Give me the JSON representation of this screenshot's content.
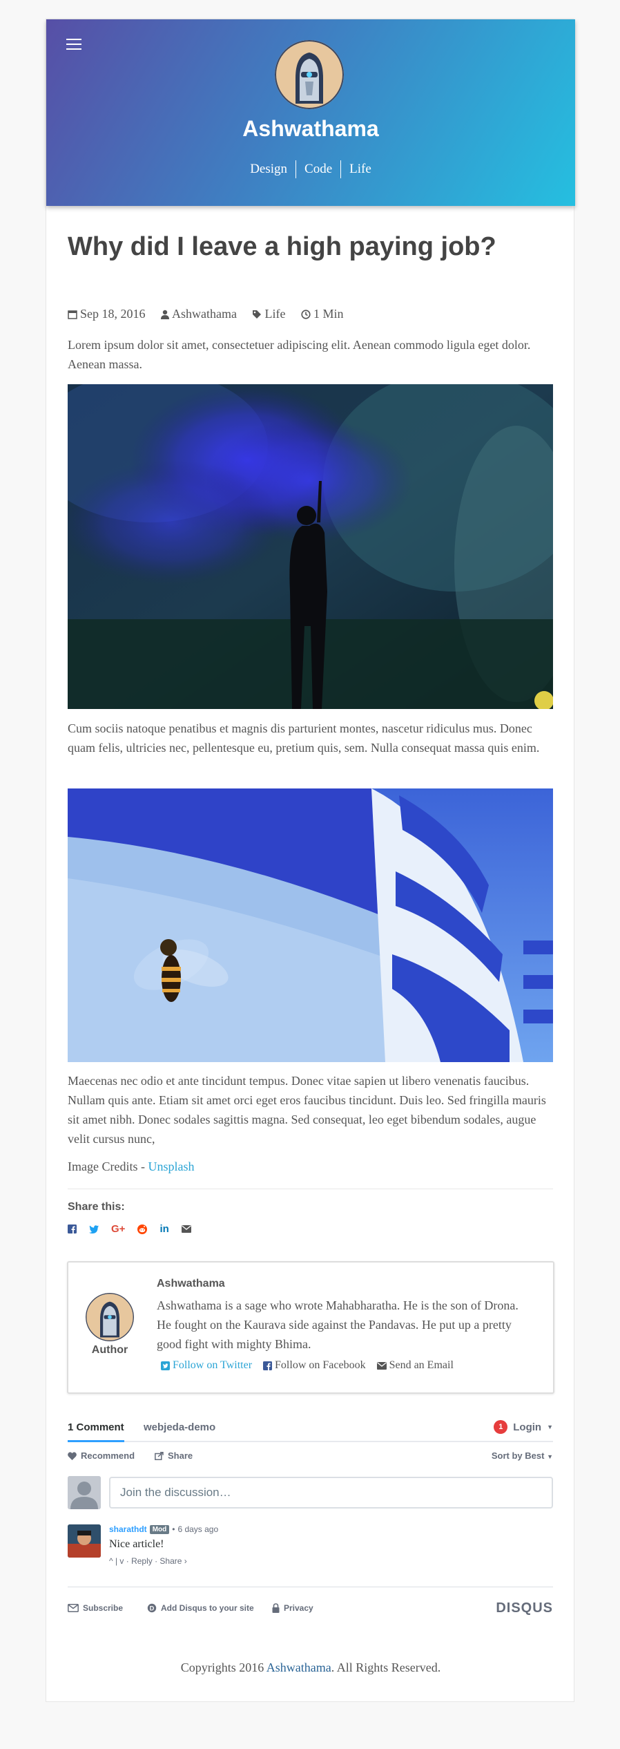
{
  "site": {
    "title": "Ashwathama",
    "nav": [
      "Design",
      "Code",
      "Life"
    ]
  },
  "post": {
    "title": "Why did I leave a high paying job?",
    "meta": {
      "date": "Sep 18, 2016",
      "author": "Ashwathama",
      "category": "Life",
      "read_time": "1 Min"
    },
    "paragraph1": "Lorem ipsum dolor sit amet, consectetuer adipiscing elit. Aenean commodo ligula eget dolor. Aenean massa.",
    "paragraph2": "Cum sociis natoque penatibus et magnis dis parturient montes, nascetur ridiculus mus. Donec quam felis, ultricies nec, pellentesque eu, pretium quis, sem. Nulla consequat massa quis enim.",
    "paragraph3": "Maecenas nec odio et ante tincidunt tempus. Donec vitae sapien ut libero venenatis faucibus. Nullam quis ante. Etiam sit amet orci eget eros faucibus tincidunt. Duis leo. Sed fringilla mauris sit amet nibh. Donec sodales sagittis magna. Sed consequat, leo eget bibendum sodales, augue velit cursus nunc,",
    "credits_prefix": "Image Credits - ",
    "credits_link": "Unsplash"
  },
  "share": {
    "title": "Share this:",
    "icons": [
      "facebook-icon",
      "twitter-icon",
      "google-plus-icon",
      "reddit-icon",
      "linkedin-icon",
      "email-icon"
    ]
  },
  "author_box": {
    "label": "Author",
    "name": "Ashwathama",
    "bio": "Ashwathama is a sage who wrote Mahabharatha. He is the son of Drona. He fought on the Kaurava side against the Pandavas. He put up a pretty good fight with mighty Bhima.",
    "twitter": "Follow on Twitter",
    "facebook": "Follow on Facebook",
    "email": "Send an Email"
  },
  "disqus": {
    "comments_tab": "1 Comment",
    "site_tab": "webjeda-demo",
    "notification_count": "1",
    "login": "Login",
    "recommend": "Recommend",
    "share": "Share",
    "sort": "Sort by Best",
    "placeholder": "Join the discussion…",
    "comment": {
      "author": "sharathdt",
      "badge": "Mod",
      "time": "6 days ago",
      "text": "Nice article!",
      "actions": "^  |  v  ·  Reply  ·  Share ›"
    },
    "footer": {
      "subscribe": "Subscribe",
      "add": "Add Disqus to your site",
      "privacy": "Privacy",
      "brand": "DISQUS"
    }
  },
  "footer": {
    "prefix": "Copyrights 2016 ",
    "link": "Ashwathama",
    "suffix": ". All Rights Reserved."
  },
  "colors": {
    "hero_start": "#574fa6",
    "hero_end": "#25bfe0",
    "link": "#2aa4d5",
    "disqus_accent": "#2e9fff"
  }
}
